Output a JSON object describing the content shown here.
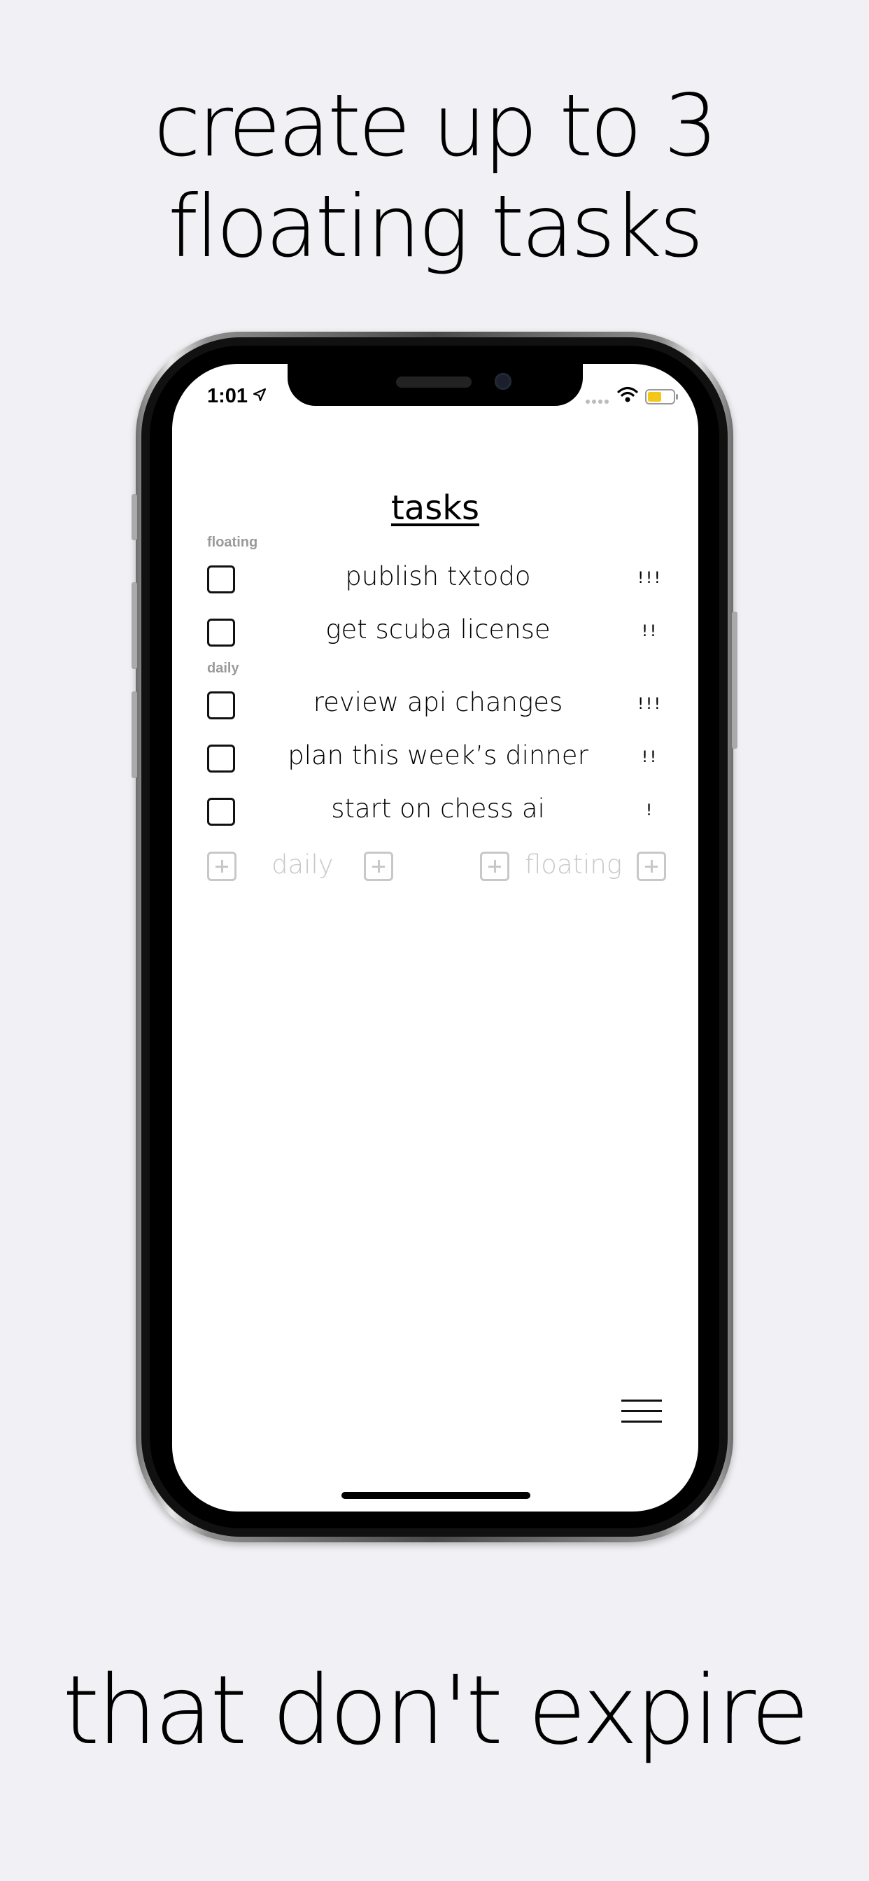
{
  "headline_top": "create up to 3\nfloating tasks",
  "headline_top_lines": [
    "create up to 3",
    "floating tasks"
  ],
  "headline_bottom": "that don't expire",
  "status_bar": {
    "time": "1:01"
  },
  "app": {
    "title": "tasks",
    "sections": [
      {
        "label": "floating",
        "tasks": [
          {
            "text": "publish txtodo",
            "priority": "!!!"
          },
          {
            "text": "get scuba license",
            "priority": "!!"
          }
        ]
      },
      {
        "label": "daily",
        "tasks": [
          {
            "text": "review api changes",
            "priority": "!!!"
          },
          {
            "text": "plan this week’s dinner",
            "priority": "!!"
          },
          {
            "text": "start on chess ai",
            "priority": "!"
          }
        ]
      }
    ],
    "add_controls": {
      "daily_label": "daily",
      "floating_label": "floating"
    }
  },
  "icons": {
    "location": "location-arrow-icon",
    "wifi": "wifi-icon",
    "battery": "battery-icon",
    "add": "plus-square-icon",
    "menu": "hamburger-menu-icon"
  },
  "colors": {
    "background": "#f1f1f5",
    "muted": "#c8c8c8",
    "battery_fill": "#f5c518"
  }
}
